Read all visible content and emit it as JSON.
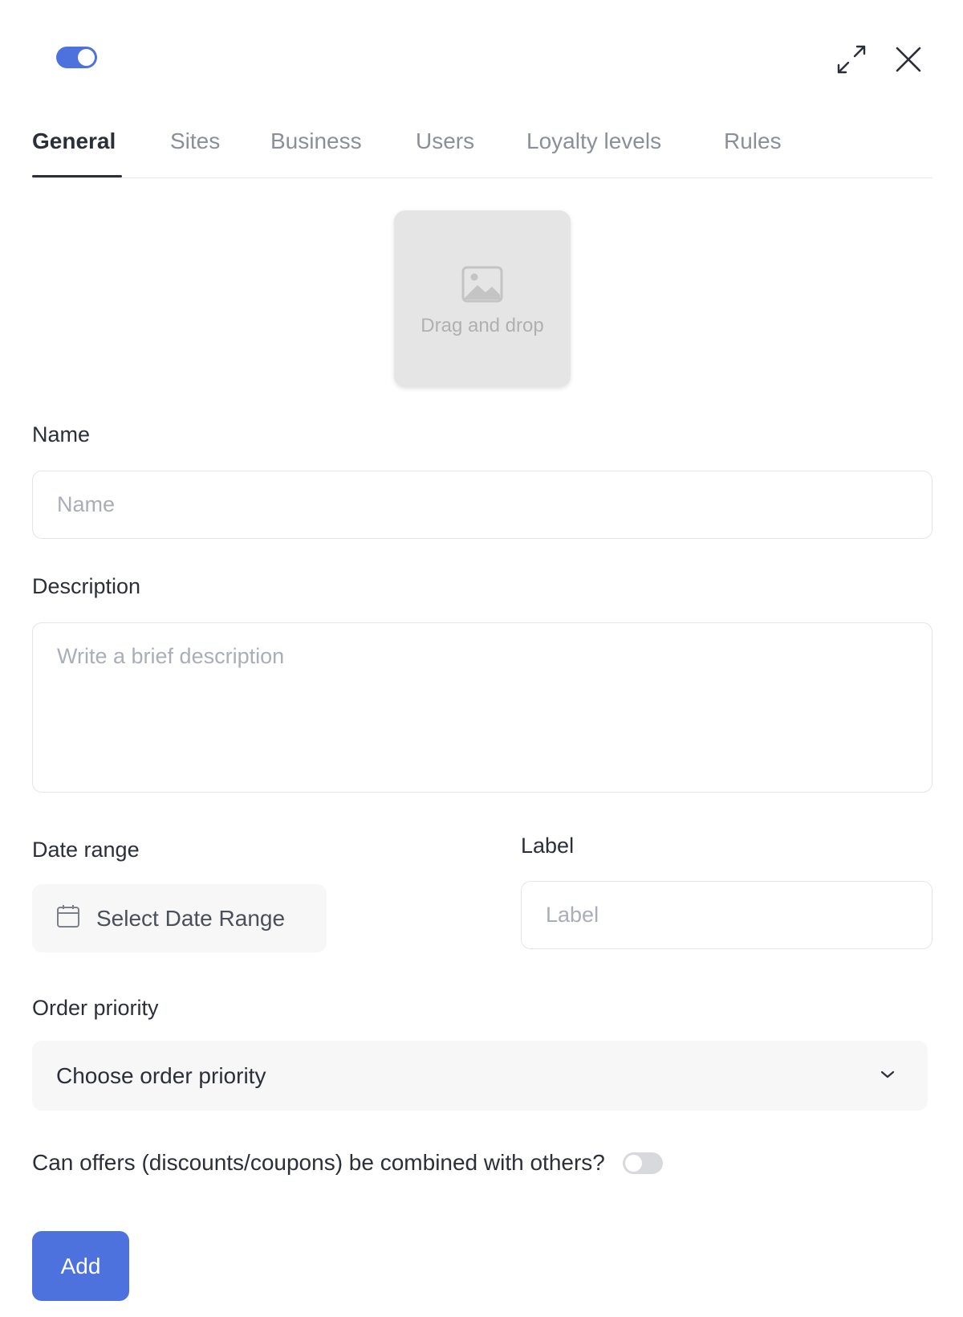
{
  "header": {
    "status_toggle": {
      "state": "on",
      "color": "#4e72dd"
    },
    "icons": {
      "expand": "expand-icon",
      "close": "close-icon"
    }
  },
  "tabs": [
    {
      "label": "General",
      "active": true
    },
    {
      "label": "Sites",
      "active": false
    },
    {
      "label": "Business",
      "active": false
    },
    {
      "label": "Users",
      "active": false
    },
    {
      "label": "Loyalty levels",
      "active": false
    },
    {
      "label": "Rules",
      "active": false
    }
  ],
  "image_upload": {
    "icon": "image-icon",
    "text": "Drag and drop"
  },
  "form": {
    "name": {
      "label": "Name",
      "placeholder": "Name",
      "value": ""
    },
    "description": {
      "label": "Description",
      "placeholder": "Write a brief description",
      "value": ""
    },
    "date_range": {
      "label": "Date range",
      "button_text": "Select Date Range",
      "icon": "calendar-icon"
    },
    "label_field": {
      "label": "Label",
      "placeholder": "Label",
      "value": ""
    },
    "order_priority": {
      "label": "Order priority",
      "selected": "Choose order priority",
      "icon": "chevron-down-icon"
    },
    "combine_offers": {
      "text": "Can offers (discounts/coupons) be combined with others?",
      "state": "off"
    }
  },
  "actions": {
    "add_label": "Add"
  },
  "colors": {
    "accent": "#4e72dd",
    "text": "#2b2f38",
    "muted": "#8a8f99"
  }
}
